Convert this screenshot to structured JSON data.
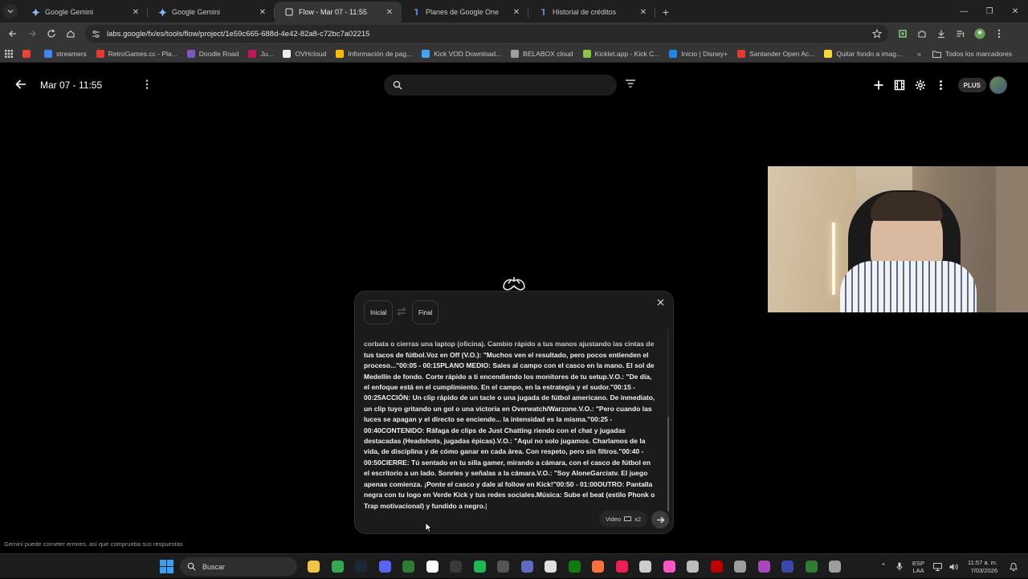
{
  "browser": {
    "tabs": [
      {
        "title": "Google Gemini",
        "active": false,
        "favicon": "gemini-icon"
      },
      {
        "title": "Google Gemini",
        "active": false,
        "favicon": "gemini-icon"
      },
      {
        "title": "Flow - Mar 07 - 11:55",
        "active": true,
        "favicon": "page-icon"
      },
      {
        "title": "Planes de Google One",
        "active": false,
        "favicon": "google-one-icon"
      },
      {
        "title": "Historial de créditos",
        "active": false,
        "favicon": "google-one-icon"
      }
    ],
    "url": "labs.google/fx/es/tools/flow/project/1e59c665-688d-4e42-82a8-c72bc7a02215",
    "bookmarks": [
      {
        "label": "",
        "color": "#ea4335"
      },
      {
        "label": "streamers",
        "color": "#4285f4"
      },
      {
        "label": "RetroGames.cc - Pla...",
        "color": "#e53935"
      },
      {
        "label": "Doodle Road",
        "color": "#7e57c2"
      },
      {
        "label": "Ju...",
        "color": "#c2185b"
      },
      {
        "label": "OVHcloud",
        "color": "#eeeeee"
      },
      {
        "label": "Información de pag...",
        "color": "#fbbc04"
      },
      {
        "label": "Kick VOD Download...",
        "color": "#42a5f5"
      },
      {
        "label": "BELABOX cloud",
        "color": "#9e9e9e"
      },
      {
        "label": "Kicklet.app - Kick C...",
        "color": "#8bc34a"
      },
      {
        "label": "Inicio | Disney+",
        "color": "#1e88e5"
      },
      {
        "label": "Santander Open Ac...",
        "color": "#e53935"
      },
      {
        "label": "Quitar fondo a imag...",
        "color": "#fdd835"
      }
    ],
    "all_bookmarks": "Todos los marcadores"
  },
  "app": {
    "project_title": "Mar 07 - 11:55",
    "plan_badge": "PLUS"
  },
  "prompt_panel": {
    "chip_start": "Inicial",
    "chip_end": "Final",
    "text": "corbata o cierras una laptop (oficina). Cambio rápido a tus manos ajustando las cintas de tus tacos de fútbol.Voz en Off (V.O.): \"Muchos ven el resultado, pero pocos entienden el proceso...\"00:05 - 00:15PLANO MEDIO: Sales al campo con el casco en la mano. El sol de Medellín de fondo. Corte rápido a ti encendiendo los monitores de tu setup.V.O.: \"De día, el enfoque está en el cumplimiento. En el campo, en la estrategia y el sudor.\"00:15 - 00:25ACCIÓN: Un clip rápido de un tacle o una jugada de fútbol americano. De inmediato, un clip tuyo gritando un gol o una victoria en Overwatch/Warzone.V.O.: \"Pero cuando las luces se apagan y el directo se enciende... la intensidad es la misma.\"00:25 - 00:40CONTENIDO: Ráfaga de clips de Just Chatting riendo con el chat y jugadas destacadas (Headshots, jugadas épicas).V.O.: \"Aquí no solo jugamos. Charlamos de la vida, de disciplina y de cómo ganar en cada área. Con respeto, pero sin filtros.\"00:40 - 00:50CIERRE: Tú sentado en tu silla gamer, mirando a cámara, con el casco de fútbol en el escritorio a un lado. Sonríes y señalas a la cámara.V.O.: \"Soy AloneGarciatv. El juego apenas comienza. ¡Ponte el casco y dale al follow en Kick!\"00:50 - 01:00OUTRO: Pantalla negra con tu logo en Verde Kick y tus redes sociales.Música: Sube el beat (estilo Phonk o Trap motivacional) y fundido a negro.",
    "mode_label": "Video",
    "mode_count": "x2"
  },
  "disclaimer": "Gemini puede cometer errores, así que comprueba sus respuestas",
  "taskbar": {
    "search_label": "Buscar",
    "apps": [
      {
        "name": "explorer-app",
        "color": "#f4c542"
      },
      {
        "name": "chrome-app",
        "color": "#34a853"
      },
      {
        "name": "steam-app",
        "color": "#1b2838"
      },
      {
        "name": "discord-app",
        "color": "#5865f2"
      },
      {
        "name": "terminal-app",
        "color": "#2e7d32"
      },
      {
        "name": "capcut-app",
        "color": "#ffffff"
      },
      {
        "name": "epic-app",
        "color": "#3a3a3a"
      },
      {
        "name": "spotify-app",
        "color": "#1db954"
      },
      {
        "name": "4k-app",
        "color": "#555555"
      },
      {
        "name": "media-app",
        "color": "#5c6bc0"
      },
      {
        "name": "g-app",
        "color": "#e0e0e0"
      },
      {
        "name": "xbox-app",
        "color": "#107c10"
      },
      {
        "name": "firefox-app",
        "color": "#ff7139"
      },
      {
        "name": "tiktok-app",
        "color": "#ee1d52"
      },
      {
        "name": "obs-app",
        "color": "#cccccc"
      },
      {
        "name": "itunes-app",
        "color": "#fa57c1"
      },
      {
        "name": "c-app",
        "color": "#bdbdbd"
      },
      {
        "name": "filezilla-app",
        "color": "#bf0000"
      },
      {
        "name": "usb-app",
        "color": "#9e9e9e"
      },
      {
        "name": "purple-app",
        "color": "#ab47bc"
      },
      {
        "name": "player-app",
        "color": "#3949ab"
      },
      {
        "name": "code-app",
        "color": "#2e7d32"
      },
      {
        "name": "settings-app",
        "color": "#9e9e9e"
      }
    ],
    "lang_top": "ESP",
    "lang_bottom": "LAA",
    "time": "11:57 a. m.",
    "date": "7/03/2026"
  }
}
